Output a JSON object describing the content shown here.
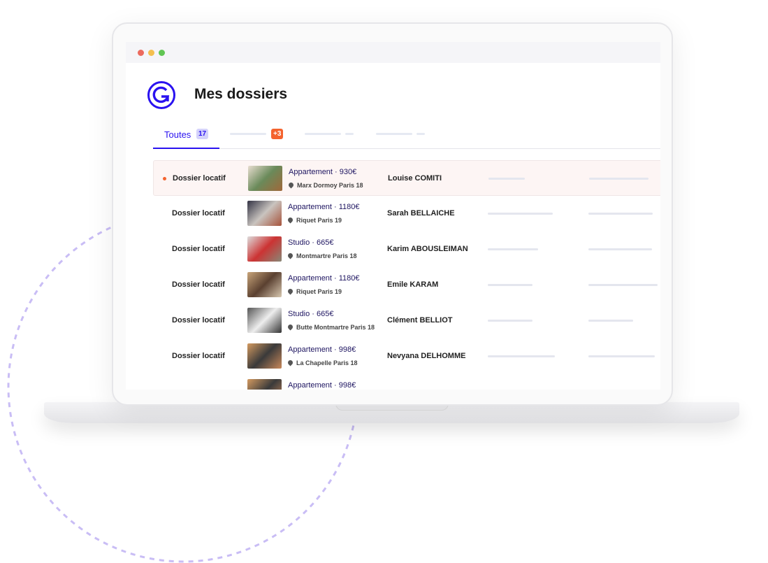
{
  "header": {
    "title": "Mes dossiers",
    "logo_letter": "G"
  },
  "tabs": {
    "active_label": "Toutes",
    "active_count": "17",
    "second_badge": "+3"
  },
  "colors": {
    "accent": "#2a12f0",
    "alert": "#f4632e",
    "decoration": "#c9bdf5"
  },
  "rows": [
    {
      "type": "Dossier locatif",
      "property": "Appartement · 930€",
      "location": "Marx Dormoy Paris 18",
      "tenant": "Louise COMITI",
      "highlighted": true
    },
    {
      "type": "Dossier locatif",
      "property": "Appartement · 1180€",
      "location": "Riquet Paris 19",
      "tenant": "Sarah BELLAICHE"
    },
    {
      "type": "Dossier locatif",
      "property": "Studio · 665€",
      "location": "Montmartre Paris 18",
      "tenant": "Karim ABOUSLEIMAN"
    },
    {
      "type": "Dossier locatif",
      "property": "Appartement · 1180€",
      "location": "Riquet Paris 19",
      "tenant": "Emile KARAM"
    },
    {
      "type": "Dossier locatif",
      "property": "Studio · 665€",
      "location": "Butte Montmartre Paris 18",
      "tenant": "Clément BELLIOT"
    },
    {
      "type": "Dossier locatif",
      "property": "Appartement · 998€",
      "location": "La Chapelle Paris 18",
      "tenant": "Nevyana DELHOMME"
    },
    {
      "property": "Appartement · 998€"
    }
  ]
}
